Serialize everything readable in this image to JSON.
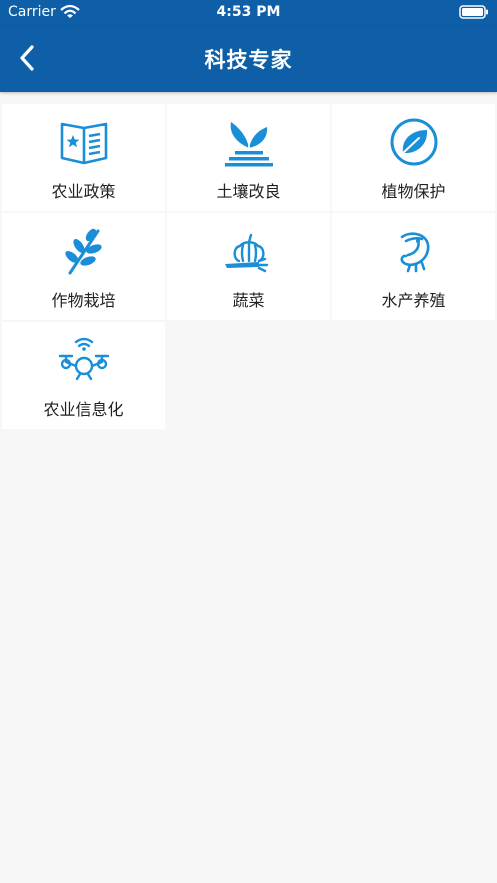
{
  "status": {
    "carrier": "Carrier",
    "time": "4:53 PM"
  },
  "nav": {
    "title": "科技专家"
  },
  "colors": {
    "brand": "#0f5fa8",
    "icon": "#1a8fd8"
  },
  "categories": [
    {
      "label": "农业政策",
      "icon": "policy-book-icon"
    },
    {
      "label": "土壤改良",
      "icon": "sprout-soil-icon"
    },
    {
      "label": "植物保护",
      "icon": "leaf-circle-icon"
    },
    {
      "label": "作物栽培",
      "icon": "wheat-branch-icon"
    },
    {
      "label": "蔬菜",
      "icon": "vegetables-icon"
    },
    {
      "label": "水产养殖",
      "icon": "shrimp-icon"
    },
    {
      "label": "农业信息化",
      "icon": "drone-icon"
    }
  ]
}
